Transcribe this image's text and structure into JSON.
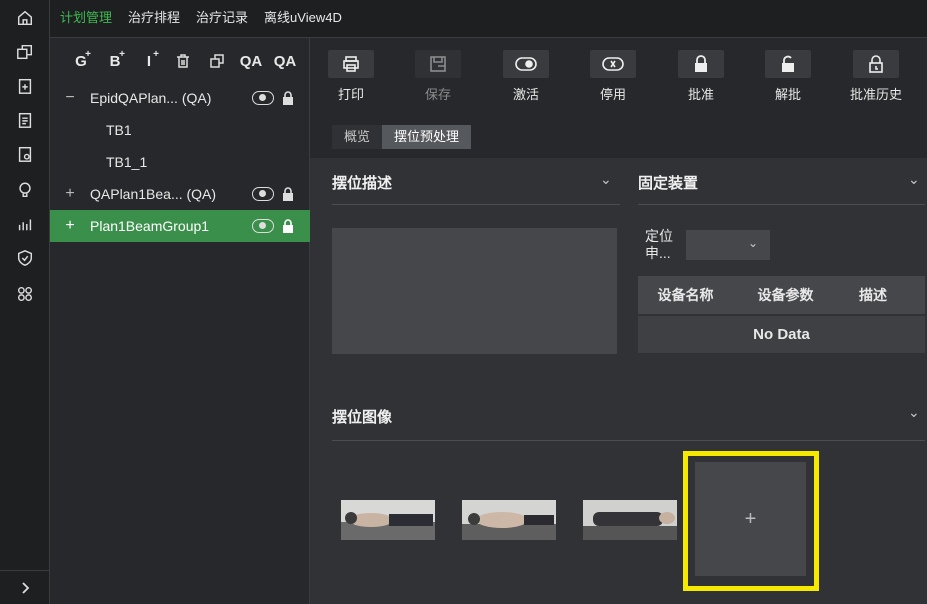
{
  "sidebar_icons": [
    "home-icon",
    "copy-icon",
    "clipboard-plus-icon",
    "document-icon",
    "clipboard-user-icon",
    "lightbulb-icon",
    "chart-icon",
    "shield-check-icon",
    "apps-icon"
  ],
  "top_tabs": [
    {
      "label": "计划管理",
      "active": true
    },
    {
      "label": "治疗排程",
      "active": false
    },
    {
      "label": "治疗记录",
      "active": false
    },
    {
      "label": "离线uView4D",
      "active": false
    }
  ],
  "tree_tools": [
    "G",
    "B",
    "I",
    "delete",
    "duplicate",
    "QA",
    "QA"
  ],
  "tree": [
    {
      "label": "EpidQAPlan... (QA)",
      "expander": "−",
      "indent": 0,
      "selected": false,
      "status": true
    },
    {
      "label": "TB1",
      "expander": "",
      "indent": 1,
      "selected": false,
      "status": false
    },
    {
      "label": "TB1_1",
      "expander": "",
      "indent": 1,
      "selected": false,
      "status": false
    },
    {
      "label": "QAPlan1Bea... (QA)",
      "expander": "+",
      "indent": 0,
      "selected": false,
      "status": true
    },
    {
      "label": "Plan1BeamGroup1",
      "expander": "+",
      "indent": 0,
      "selected": true,
      "status": true
    }
  ],
  "toolbar": {
    "print": "打印",
    "save": "保存",
    "activate": "激活",
    "deactivate": "停用",
    "approve": "批准",
    "unapprove": "解批",
    "approve_history": "批准历史"
  },
  "subtabs": {
    "overview": "概览",
    "setup_preprocess": "摆位预处理"
  },
  "sections": {
    "setup_desc": "摆位描述",
    "fixation": "固定装置",
    "setup_images": "摆位图像"
  },
  "fixation": {
    "position_label": "定位申...",
    "columns": [
      "设备名称",
      "设备参数",
      "描述"
    ],
    "empty": "No Data"
  },
  "add_image": "+",
  "colors": {
    "accent": "#3fb950",
    "selected": "#3a8f4b",
    "highlight": "#f5e900"
  }
}
